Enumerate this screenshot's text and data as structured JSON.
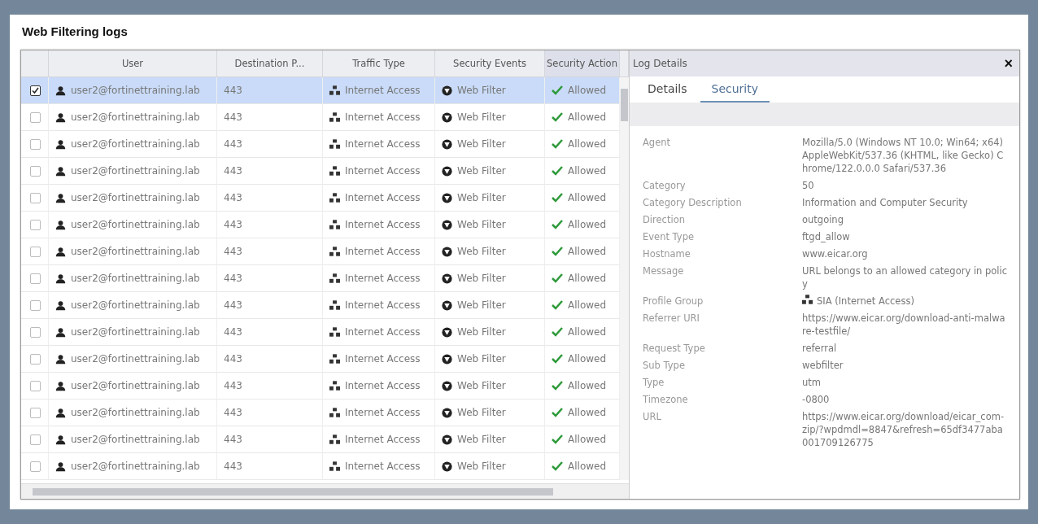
{
  "title": "Web Filtering logs",
  "table": {
    "columns": [
      "User",
      "Destination P...",
      "Traffic Type",
      "Security Events",
      "Security Action"
    ],
    "rows": [
      {
        "selected": true,
        "user": "user2@fortinettraining.lab",
        "port": "443",
        "traffic": "Internet Access",
        "event": "Web Filter",
        "action": "Allowed"
      },
      {
        "selected": false,
        "user": "user2@fortinettraining.lab",
        "port": "443",
        "traffic": "Internet Access",
        "event": "Web Filter",
        "action": "Allowed"
      },
      {
        "selected": false,
        "user": "user2@fortinettraining.lab",
        "port": "443",
        "traffic": "Internet Access",
        "event": "Web Filter",
        "action": "Allowed"
      },
      {
        "selected": false,
        "user": "user2@fortinettraining.lab",
        "port": "443",
        "traffic": "Internet Access",
        "event": "Web Filter",
        "action": "Allowed"
      },
      {
        "selected": false,
        "user": "user2@fortinettraining.lab",
        "port": "443",
        "traffic": "Internet Access",
        "event": "Web Filter",
        "action": "Allowed"
      },
      {
        "selected": false,
        "user": "user2@fortinettraining.lab",
        "port": "443",
        "traffic": "Internet Access",
        "event": "Web Filter",
        "action": "Allowed"
      },
      {
        "selected": false,
        "user": "user2@fortinettraining.lab",
        "port": "443",
        "traffic": "Internet Access",
        "event": "Web Filter",
        "action": "Allowed"
      },
      {
        "selected": false,
        "user": "user2@fortinettraining.lab",
        "port": "443",
        "traffic": "Internet Access",
        "event": "Web Filter",
        "action": "Allowed"
      },
      {
        "selected": false,
        "user": "user2@fortinettraining.lab",
        "port": "443",
        "traffic": "Internet Access",
        "event": "Web Filter",
        "action": "Allowed"
      },
      {
        "selected": false,
        "user": "user2@fortinettraining.lab",
        "port": "443",
        "traffic": "Internet Access",
        "event": "Web Filter",
        "action": "Allowed"
      },
      {
        "selected": false,
        "user": "user2@fortinettraining.lab",
        "port": "443",
        "traffic": "Internet Access",
        "event": "Web Filter",
        "action": "Allowed"
      },
      {
        "selected": false,
        "user": "user2@fortinettraining.lab",
        "port": "443",
        "traffic": "Internet Access",
        "event": "Web Filter",
        "action": "Allowed"
      },
      {
        "selected": false,
        "user": "user2@fortinettraining.lab",
        "port": "443",
        "traffic": "Internet Access",
        "event": "Web Filter",
        "action": "Allowed"
      },
      {
        "selected": false,
        "user": "user2@fortinettraining.lab",
        "port": "443",
        "traffic": "Internet Access",
        "event": "Web Filter",
        "action": "Allowed"
      },
      {
        "selected": false,
        "user": "user2@fortinettraining.lab",
        "port": "443",
        "traffic": "Internet Access",
        "event": "Web Filter",
        "action": "Allowed"
      }
    ]
  },
  "details": {
    "title": "Log Details",
    "close": "×",
    "tabs": [
      {
        "label": "Details",
        "selected": false
      },
      {
        "label": "Security",
        "selected": true
      }
    ],
    "fields": [
      {
        "kind": "text",
        "label": "Agent",
        "value": "Mozilla/5.0 (Windows NT 10.0; Win64; x64) AppleWebKit/537.36 (KHTML, like Gecko) Chrome/122.0.0.0 Safari/537.36"
      },
      {
        "kind": "text",
        "label": "Category",
        "value": "50"
      },
      {
        "kind": "text",
        "label": "Category Description",
        "value": "Information and Computer Security"
      },
      {
        "kind": "text",
        "label": "Direction",
        "value": "outgoing"
      },
      {
        "kind": "text",
        "label": "Event Type",
        "value": "ftgd_allow"
      },
      {
        "kind": "text",
        "label": "Hostname",
        "value": "www.eicar.org"
      },
      {
        "kind": "text",
        "label": "Message",
        "value": "URL belongs to an allowed category in policy"
      },
      {
        "kind": "group",
        "label": "Profile Group",
        "value": "SIA (Internet Access)"
      },
      {
        "kind": "text",
        "label": "Referrer URI",
        "value": "https://www.eicar.org/download-anti-malware-testfile/"
      },
      {
        "kind": "text",
        "label": "Request Type",
        "value": "referral"
      },
      {
        "kind": "text",
        "label": "Sub Type",
        "value": "webfilter"
      },
      {
        "kind": "text",
        "label": "Type",
        "value": "utm"
      },
      {
        "kind": "text",
        "label": "Timezone",
        "value": "-0800"
      },
      {
        "kind": "text",
        "label": "URL",
        "value": "https://www.eicar.org/download/eicar_com-zip/?wpdmdl=8847&refresh=65df3477aba001709126775"
      }
    ]
  }
}
